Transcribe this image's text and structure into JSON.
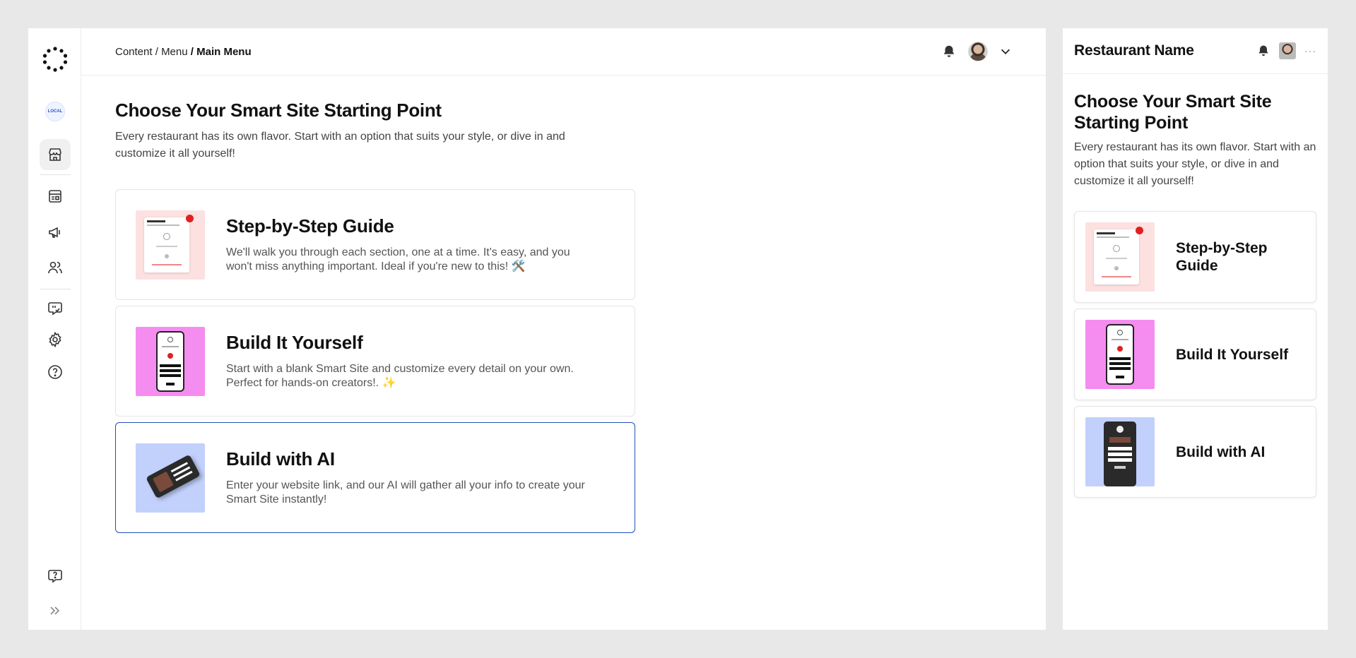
{
  "breadcrumb": {
    "part1": "Content",
    "sep1": " / ",
    "part2": "Menu",
    "sep2": " / ",
    "current": "Main Menu"
  },
  "brand_badge": "LOCAL",
  "page": {
    "title": "Choose Your Smart Site Starting Point",
    "subtitle": "Every restaurant has its own flavor. Start with an option that suits your style, or dive in and customize it all yourself!"
  },
  "options": [
    {
      "title": "Step-by-Step Guide",
      "description": "We'll walk you through each section, one at a time. It's easy, and you won't miss anything important. Ideal if you're new to this! 🛠️"
    },
    {
      "title": "Build It Yourself",
      "description": "Start with a blank Smart Site and customize every detail on your own. Perfect for hands-on creators!. ✨"
    },
    {
      "title": "Build with AI",
      "description": "Enter your website link, and our AI will gather all your info to create your Smart Site instantly!"
    }
  ],
  "preview": {
    "restaurant_name": "Restaurant Name",
    "more_label": "···",
    "title": "Choose Your Smart Site Starting Point",
    "subtitle": "Every restaurant has its own flavor. Start with an option that suits your style, or dive in and customize it all yourself!",
    "options": [
      "Step-by-Step Guide",
      "Build It Yourself",
      "Build with AI"
    ]
  },
  "colors": {
    "selected_border": "#1f4fb5",
    "pink_thumb": "#fde0e0",
    "magenta_thumb": "#f58cf0",
    "blue_thumb": "#c2d0fc"
  },
  "icons": {
    "sidebar": [
      "logo-icon",
      "store-icon",
      "menu-board-icon",
      "megaphone-icon",
      "users-icon",
      "chat-check-icon",
      "gear-icon",
      "help-circle-icon",
      "support-chat-icon",
      "expand-icon"
    ],
    "topbar": [
      "bell-icon",
      "avatar",
      "chevron-down-icon"
    ]
  }
}
